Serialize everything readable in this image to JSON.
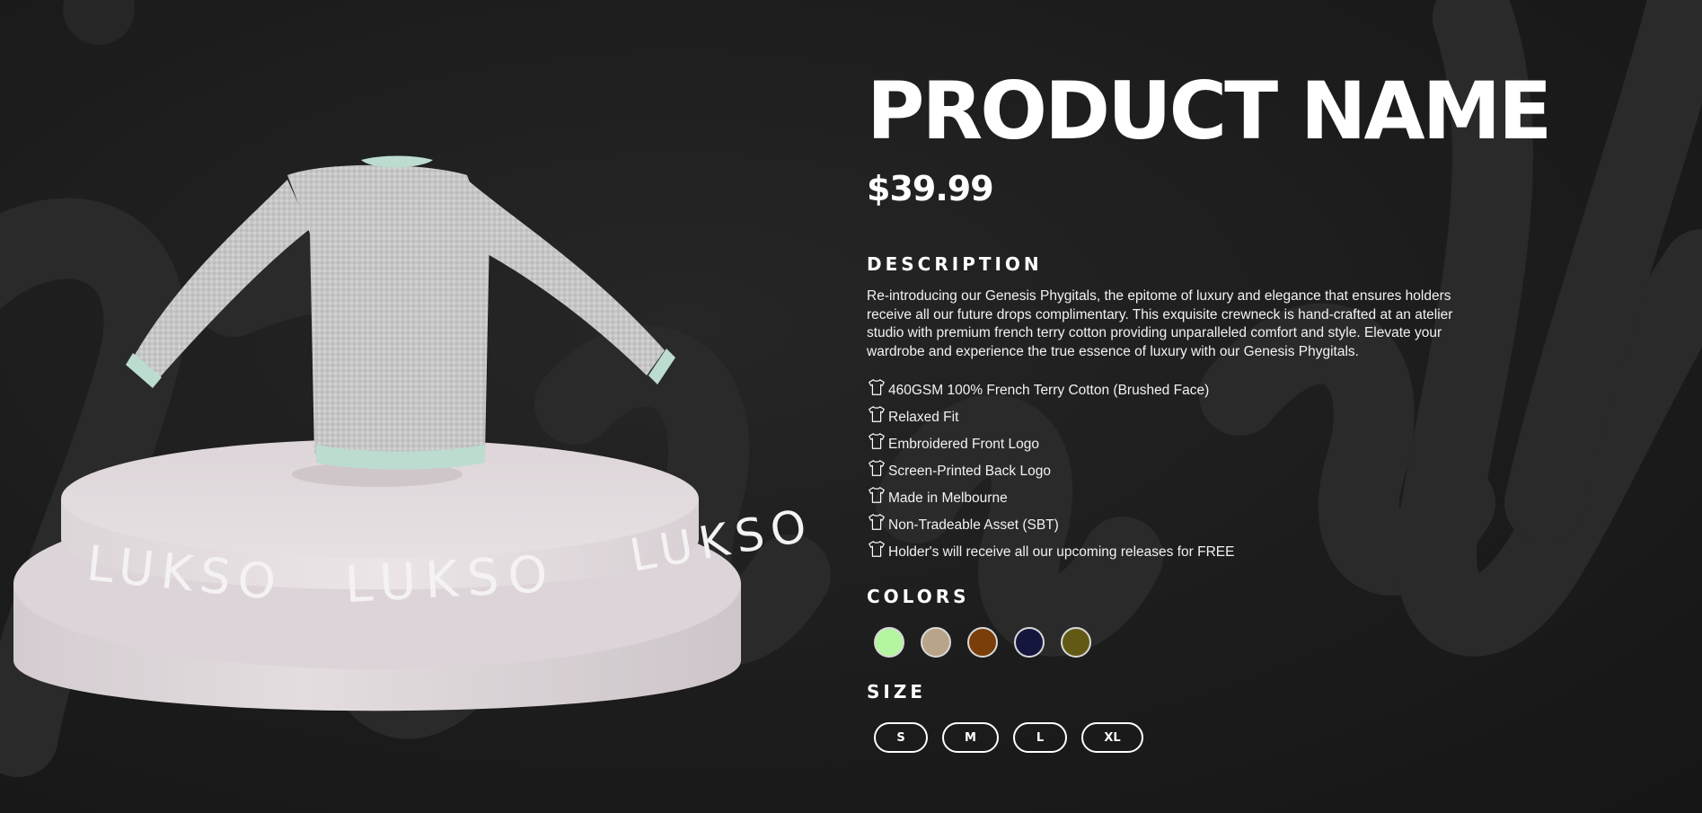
{
  "product": {
    "name": "PRODUCT NAME",
    "price": "$39.99"
  },
  "description": {
    "heading": "DESCRIPTION",
    "text": "Re-introducing our Genesis Phygitals, the epitome of luxury and elegance that ensures holders receive all our future drops complimentary. This exquisite crewneck is hand-crafted at an atelier studio with premium french terry cotton providing unparalleled comfort and style. Elevate your wardrobe and experience the true essence of luxury with our Genesis Phygitals."
  },
  "features": [
    {
      "icon": "shirt-icon",
      "label": "460GSM 100% French Terry Cotton (Brushed Face)"
    },
    {
      "icon": "shirt-icon",
      "label": "Relaxed Fit"
    },
    {
      "icon": "shirt-icon",
      "label": "Embroidered Front Logo"
    },
    {
      "icon": "shirt-icon",
      "label": "Screen-Printed Back Logo"
    },
    {
      "icon": "shirt-icon",
      "label": "Made in Melbourne"
    },
    {
      "icon": "shirt-icon",
      "label": "Non-Tradeable Asset (SBT)"
    },
    {
      "icon": "shirt-icon",
      "label": "Holder's will receive all our upcoming releases for FREE"
    }
  ],
  "colors": {
    "heading": "COLORS",
    "swatches": [
      "#b3f5a0",
      "#b9a48a",
      "#7a3e0a",
      "#15163e",
      "#625a14"
    ]
  },
  "size": {
    "heading": "SIZE",
    "options": [
      "S",
      "M",
      "L",
      "XL"
    ]
  },
  "pedestal": {
    "brand_text": "LUKSO"
  },
  "theme": {
    "background": "#1a1a1a",
    "text": "#ffffff",
    "pedestal": "#e2dcdf",
    "sweater": "#c9c9c9",
    "sweater_trim": "#bcdcd0"
  }
}
